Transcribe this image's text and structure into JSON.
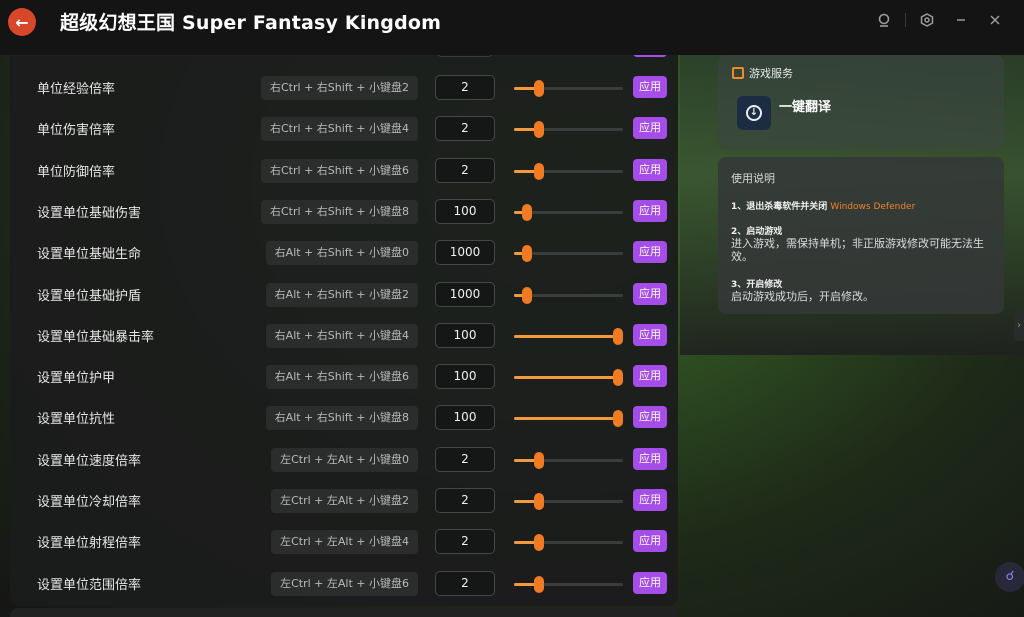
{
  "app": {
    "title": "超级幻想王国 Super Fantasy Kingdom",
    "back_icon": "back-arrow-icon",
    "accent_color": "#d9472a",
    "apply_color": "#a54de8",
    "slider_color": "#f49a3c"
  },
  "window_controls": [
    "user-icon",
    "settings-icon",
    "minimize-icon",
    "close-icon"
  ],
  "cheats": [
    {
      "label": "单位经验倍率",
      "hotkey": "右Ctrl + 右Shift + 小键盘2",
      "value": "2",
      "slider": 0.2,
      "apply": "应用"
    },
    {
      "label": "单位伤害倍率",
      "hotkey": "右Ctrl + 右Shift + 小键盘4",
      "value": "2",
      "slider": 0.2,
      "apply": "应用"
    },
    {
      "label": "单位防御倍率",
      "hotkey": "右Ctrl + 右Shift + 小键盘6",
      "value": "2",
      "slider": 0.2,
      "apply": "应用"
    },
    {
      "label": "设置单位基础伤害",
      "hotkey": "右Ctrl + 右Shift + 小键盘8",
      "value": "100",
      "slider": 0.08,
      "apply": "应用"
    },
    {
      "label": "设置单位基础生命",
      "hotkey": "右Alt + 右Shift + 小键盘0",
      "value": "1000",
      "slider": 0.08,
      "apply": "应用"
    },
    {
      "label": "设置单位基础护盾",
      "hotkey": "右Alt + 右Shift + 小键盘2",
      "value": "1000",
      "slider": 0.08,
      "apply": "应用"
    },
    {
      "label": "设置单位基础暴击率",
      "hotkey": "右Alt + 右Shift + 小键盘4",
      "value": "100",
      "slider": 1.0,
      "apply": "应用"
    },
    {
      "label": "设置单位护甲",
      "hotkey": "右Alt + 右Shift + 小键盘6",
      "value": "100",
      "slider": 1.0,
      "apply": "应用"
    },
    {
      "label": "设置单位抗性",
      "hotkey": "右Alt + 右Shift + 小键盘8",
      "value": "100",
      "slider": 1.0,
      "apply": "应用"
    },
    {
      "label": "设置单位速度倍率",
      "hotkey": "左Ctrl + 左Alt + 小键盘0",
      "value": "2",
      "slider": 0.2,
      "apply": "应用"
    },
    {
      "label": "设置单位冷却倍率",
      "hotkey": "左Ctrl + 左Alt + 小键盘2",
      "value": "2",
      "slider": 0.2,
      "apply": "应用"
    },
    {
      "label": "设置单位射程倍率",
      "hotkey": "左Ctrl + 左Alt + 小键盘4",
      "value": "2",
      "slider": 0.2,
      "apply": "应用"
    },
    {
      "label": "设置单位范围倍率",
      "hotkey": "左Ctrl + 左Alt + 小键盘6",
      "value": "2",
      "slider": 0.2,
      "apply": "应用"
    }
  ],
  "service": {
    "header": "游戏服务",
    "item_label": "一键翻译"
  },
  "usage": {
    "title": "使用说明",
    "step1_title": "1、退出杀毒软件并关闭",
    "step1_accent": "Windows Defender",
    "step2_title": "2、启动游戏",
    "step2_text": "进入游戏，需保持单机；非正版游戏修改可能无法生效。",
    "step3_title": "3、开启修改",
    "step3_text": "启动游戏成功后，开启修改。"
  }
}
